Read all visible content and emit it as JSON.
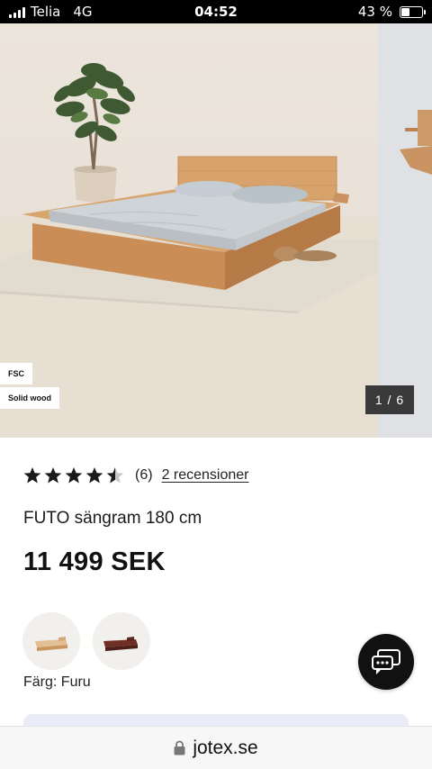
{
  "status_bar": {
    "carrier": "Telia",
    "network": "4G",
    "time": "04:52",
    "battery_text": "43 %",
    "battery_level": 0.43
  },
  "gallery": {
    "badges": [
      "FSC",
      "Solid wood"
    ],
    "counter": "1 / 6",
    "current": 1,
    "total": 6
  },
  "product": {
    "rating_value": 4.5,
    "rating_count": "(6)",
    "reviews_link": "2 recensioner",
    "title": "FUTO sängram 180 cm",
    "price": "11 499 SEK",
    "color_label": "Färg: Furu",
    "swatches": [
      "light-pine-bed-swatch",
      "dark-wood-bed-swatch"
    ]
  },
  "browser": {
    "url": "jotex.se",
    "lock_icon": "lock-icon"
  },
  "colors": {
    "accent": "#111111",
    "info_strip": "#e9ecf7"
  }
}
